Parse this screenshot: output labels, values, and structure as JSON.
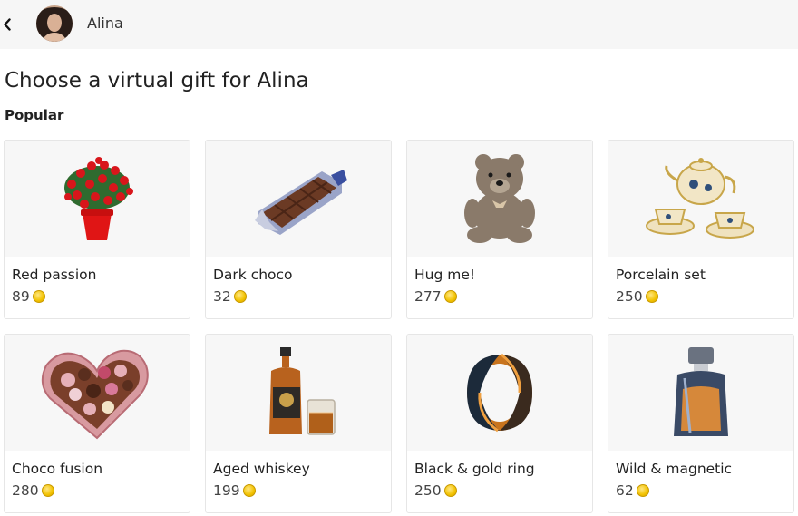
{
  "header": {
    "user_name": "Alina",
    "back_icon": "chevron-left-icon",
    "avatar_icon": "avatar"
  },
  "page": {
    "title": "Choose a virtual gift for Alina",
    "section_title": "Popular"
  },
  "currency_icon": "coin-icon",
  "gifts": [
    {
      "name": "Red passion",
      "price": "89",
      "image": "red-roses-pot"
    },
    {
      "name": "Dark choco",
      "price": "32",
      "image": "chocolate-bar"
    },
    {
      "name": "Hug me!",
      "price": "277",
      "image": "teddy-bear"
    },
    {
      "name": "Porcelain set",
      "price": "250",
      "image": "tea-set"
    },
    {
      "name": "Choco fusion",
      "price": "280",
      "image": "heart-chocolate-box"
    },
    {
      "name": "Aged whiskey",
      "price": "199",
      "image": "whiskey-bottle"
    },
    {
      "name": "Black & gold ring",
      "price": "250",
      "image": "ring"
    },
    {
      "name": "Wild & magnetic",
      "price": "62",
      "image": "perfume-bottle"
    }
  ]
}
